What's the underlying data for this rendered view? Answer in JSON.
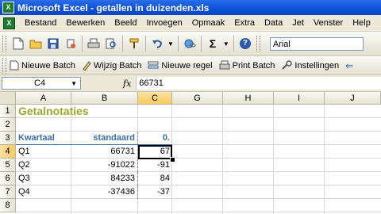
{
  "window": {
    "title": "Microsoft Excel - getallen in duizenden.xls",
    "app_icon_glyph": "X"
  },
  "menu": [
    "Bestand",
    "Bewerken",
    "Beeld",
    "Invoegen",
    "Opmaak",
    "Extra",
    "Data",
    "Jet",
    "Venster",
    "Help"
  ],
  "toolbar": {
    "font": "Arial",
    "sigma": "Σ",
    "help": "?"
  },
  "toolbar2": [
    "Nieuwe Batch",
    "Wijzig Batch",
    "Nieuwe regel",
    "Print Batch",
    "Instellingen"
  ],
  "formula_bar": {
    "name_box": "C4",
    "fx": "fx",
    "formula": "66731"
  },
  "columns": [
    "A",
    "B",
    "C",
    "G",
    "H",
    "I",
    "J"
  ],
  "rows": [
    "1",
    "2",
    "3",
    "4",
    "5",
    "6",
    "7",
    "8"
  ],
  "sheet": {
    "title": "Getalnotaties",
    "headers": {
      "a": "Kwartaal",
      "b": "standaard",
      "c": "0."
    },
    "data": [
      {
        "q": "Q1",
        "standard": "66731",
        "thousands": "67"
      },
      {
        "q": "Q2",
        "standard": "-91022",
        "thousands": "-91"
      },
      {
        "q": "Q3",
        "standard": "84233",
        "thousands": "84"
      },
      {
        "q": "Q4",
        "standard": "-37436",
        "thousands": "-37"
      }
    ]
  },
  "colors": {
    "title_green": "#9aaa2a",
    "header_blue": "#3a6faa",
    "titlebar_blue": "#0a4fd6"
  }
}
